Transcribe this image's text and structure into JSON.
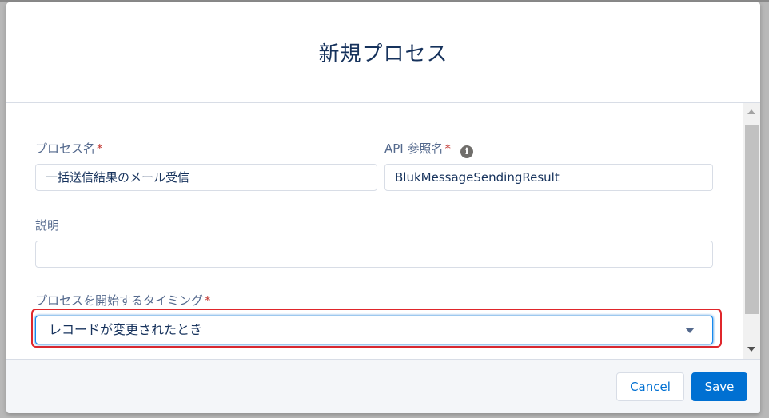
{
  "modal": {
    "title": "新規プロセス"
  },
  "form": {
    "process_name": {
      "label": "プロセス名",
      "required_mark": "*",
      "value": "一括送信結果のメール受信"
    },
    "api_name": {
      "label": "API 参照名",
      "required_mark": "*",
      "info_icon": "info-icon",
      "info_glyph": "i",
      "value": "BlukMessageSendingResult"
    },
    "description": {
      "label": "説明",
      "value": ""
    },
    "trigger_timing": {
      "label": "プロセスを開始するタイミング",
      "required_mark": "*",
      "selected": "レコードが変更されたとき",
      "caret_icon": "chevron-down-icon"
    }
  },
  "footer": {
    "cancel_label": "Cancel",
    "save_label": "Save"
  },
  "colors": {
    "brand": "#0070d2",
    "required": "#c23934",
    "highlight": "#e0262b",
    "label": "#54698d",
    "text": "#16325c"
  }
}
